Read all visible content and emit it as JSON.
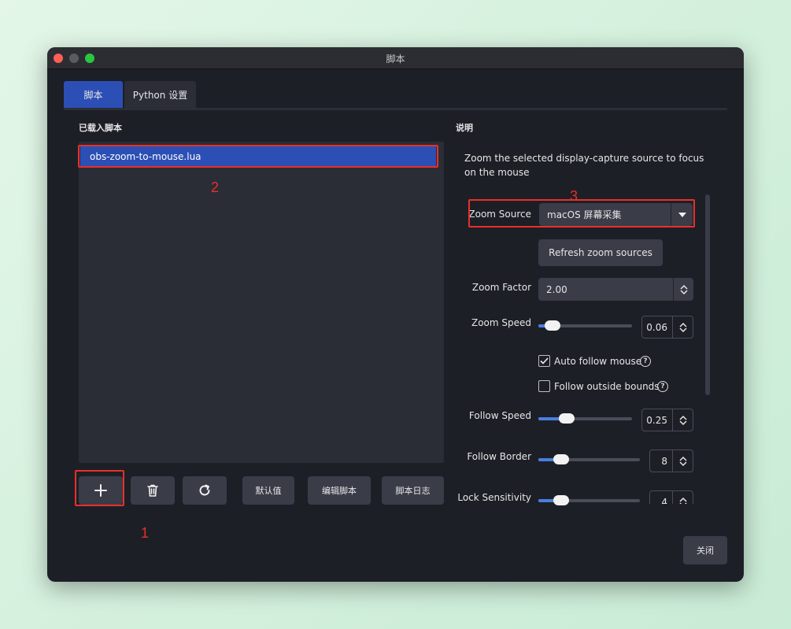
{
  "window": {
    "title": "脚本"
  },
  "tabs": [
    {
      "label": "脚本",
      "active": true
    },
    {
      "label": "Python 设置",
      "active": false
    }
  ],
  "loaded_scripts": {
    "label": "已载入脚本",
    "items": [
      {
        "name": "obs-zoom-to-mouse.lua",
        "selected": true
      }
    ]
  },
  "annotations": {
    "one": "1",
    "two": "2",
    "three": "3"
  },
  "toolbar": {
    "add_icon": "plus-icon",
    "remove_icon": "trash-icon",
    "reload_icon": "refresh-icon",
    "defaults_label": "默认值",
    "edit_label": "编辑脚本",
    "log_label": "脚本日志"
  },
  "description": {
    "label": "说明",
    "text": "Zoom the selected display-capture source to focus on the mouse"
  },
  "settings": {
    "zoom_source": {
      "label": "Zoom Source",
      "value": "macOS 屏幕采集"
    },
    "refresh_label": "Refresh zoom sources",
    "zoom_factor": {
      "label": "Zoom Factor",
      "value": "2.00"
    },
    "zoom_speed": {
      "label": "Zoom Speed",
      "value": "0.06",
      "level": 0.06
    },
    "auto_follow": {
      "label": "Auto follow mouse",
      "checked": true
    },
    "follow_outside": {
      "label": "Follow outside bounds",
      "checked": false
    },
    "follow_speed": {
      "label": "Follow Speed",
      "value": "0.25",
      "level": 0.25
    },
    "follow_border": {
      "label": "Follow Border",
      "value": "8",
      "level": 0.16
    },
    "lock_sensitivity": {
      "label": "Lock Sensitivity",
      "value": "4",
      "level": 0.16
    }
  },
  "close_label": "关闭",
  "colors": {
    "accent": "#2c4fb5",
    "highlight": "#e8302a",
    "background": "#1d1f26"
  }
}
